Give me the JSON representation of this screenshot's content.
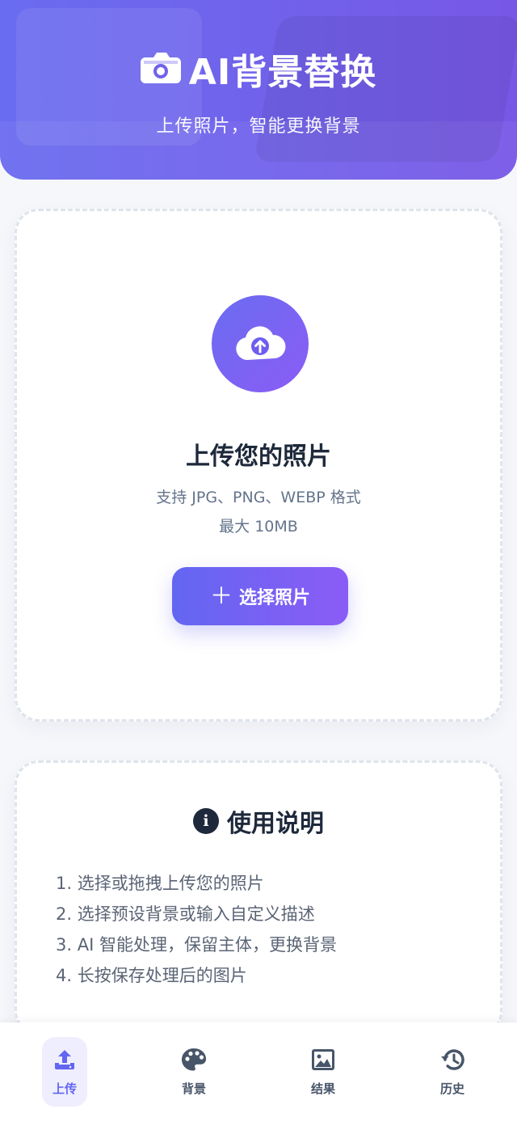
{
  "header": {
    "title": "AI背景替换",
    "subtitle": "上传照片，智能更换背景",
    "icon": "camera-icon"
  },
  "upload": {
    "icon": "cloud-upload-icon",
    "title": "上传您的照片",
    "formats": "支持 JPG、PNG、WEBP 格式",
    "max_size": "最大 10MB",
    "button_label": "选择照片",
    "button_icon": "plus-icon"
  },
  "help": {
    "icon": "info-icon",
    "title": "使用说明",
    "steps": [
      "1. 选择或拖拽上传您的照片",
      "2. 选择预设背景或输入自定义描述",
      "3. AI 智能处理，保留主体，更换背景",
      "4. 长按保存处理后的图片"
    ]
  },
  "tabs": [
    {
      "label": "上传",
      "icon": "upload-icon",
      "active": true
    },
    {
      "label": "背景",
      "icon": "palette-icon",
      "active": false
    },
    {
      "label": "结果",
      "icon": "image-icon",
      "active": false
    },
    {
      "label": "历史",
      "icon": "history-icon",
      "active": false
    }
  ],
  "colors": {
    "accent": "#6366f1",
    "accent_end": "#8b5cf6",
    "text_dark": "#1e293b",
    "text_muted": "#64748b"
  }
}
